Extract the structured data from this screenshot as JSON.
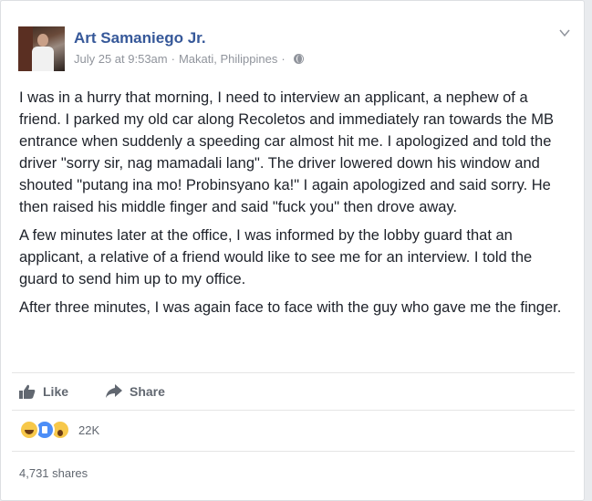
{
  "post": {
    "author": "Art Samaniego Jr.",
    "date": "July 25 at 9:53am",
    "separator": "·",
    "location": "Makati, Philippines",
    "separator2": "·",
    "paragraphs": [
      "I was in a hurry that morning, I need to interview an applicant, a nephew of a friend. I parked my old car along Recoletos and immediately ran towards the MB entrance when suddenly a speeding car almost hit me. I apologized and told the driver \"sorry sir, nag mamadali lang\". The driver lowered down his window and shouted \"putang ina mo! Probinsyano ka!\" I again apologized and said sorry. He then raised his middle finger and said \"fuck you\" then drove away.",
      "A few minutes later at the office, I was informed by the lobby guard that an applicant, a relative of a friend would like to see me for an interview. I told the guard to send him up to my office.",
      "After three minutes, I was again face to face with the guy who gave me the finger."
    ]
  },
  "actions": {
    "like": "Like",
    "share": "Share"
  },
  "reactions": {
    "icons": [
      "haha",
      "like",
      "wow"
    ],
    "count": "22K"
  },
  "shares": "4,731 shares",
  "colors": {
    "link": "#365899",
    "meta": "#90949c",
    "action": "#616770"
  }
}
